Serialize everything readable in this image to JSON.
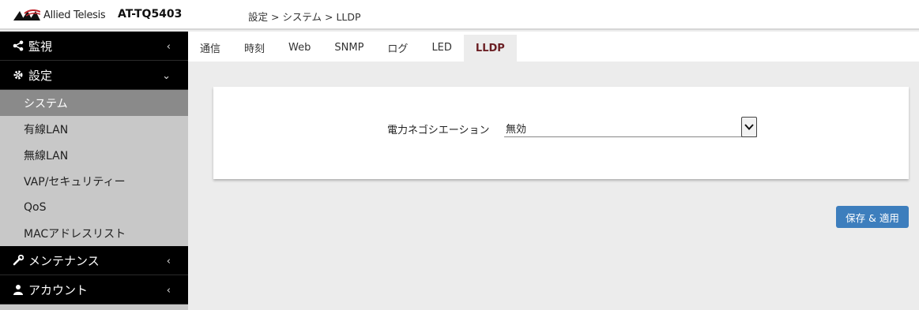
{
  "header": {
    "brand": "Allied Telesis",
    "model": "AT-TQ5403",
    "breadcrumb": "設定 > システム > LLDP"
  },
  "sidebar": {
    "sections": [
      {
        "label": "監視",
        "icon": "share-icon"
      },
      {
        "label": "設定",
        "icon": "gear-icon"
      },
      {
        "label": "メンテナンス",
        "icon": "wrench-icon"
      },
      {
        "label": "アカウント",
        "icon": "user-icon"
      }
    ],
    "items": [
      {
        "label": "システム"
      },
      {
        "label": "有線LAN"
      },
      {
        "label": "無線LAN"
      },
      {
        "label": "VAP/セキュリティー"
      },
      {
        "label": "QoS"
      },
      {
        "label": "MACアドレスリスト"
      }
    ]
  },
  "tabs": [
    {
      "label": "通信"
    },
    {
      "label": "時刻"
    },
    {
      "label": "Web"
    },
    {
      "label": "SNMP"
    },
    {
      "label": "ログ"
    },
    {
      "label": "LED"
    },
    {
      "label": "LLDP"
    }
  ],
  "form": {
    "power_negotiation_label": "電力ネゴシエーション",
    "power_negotiation_value": "無効"
  },
  "actions": {
    "save_label": "保存 & 適用"
  },
  "colors": {
    "accent": "#3d7ebd",
    "active_tab": "#6b1f24",
    "sidebar_header": "#000000"
  }
}
